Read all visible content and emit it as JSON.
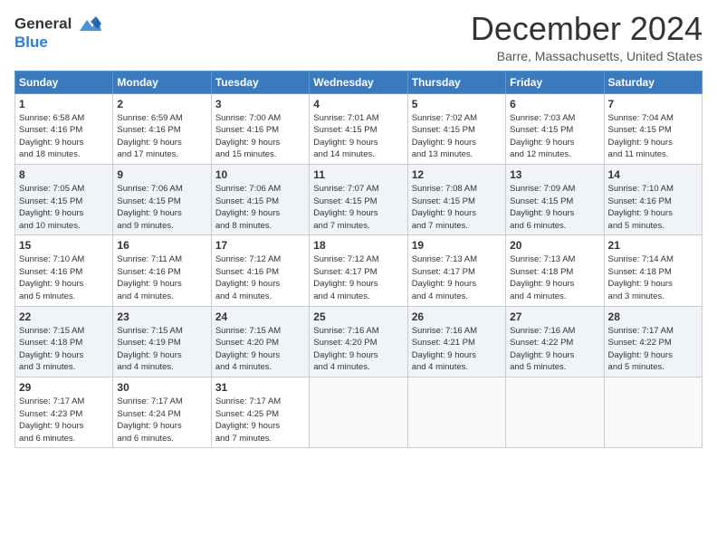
{
  "header": {
    "logo_line1": "General",
    "logo_line2": "Blue",
    "month": "December 2024",
    "location": "Barre, Massachusetts, United States"
  },
  "days_of_week": [
    "Sunday",
    "Monday",
    "Tuesday",
    "Wednesday",
    "Thursday",
    "Friday",
    "Saturday"
  ],
  "weeks": [
    [
      {
        "day": "1",
        "info": "Sunrise: 6:58 AM\nSunset: 4:16 PM\nDaylight: 9 hours\nand 18 minutes."
      },
      {
        "day": "2",
        "info": "Sunrise: 6:59 AM\nSunset: 4:16 PM\nDaylight: 9 hours\nand 17 minutes."
      },
      {
        "day": "3",
        "info": "Sunrise: 7:00 AM\nSunset: 4:16 PM\nDaylight: 9 hours\nand 15 minutes."
      },
      {
        "day": "4",
        "info": "Sunrise: 7:01 AM\nSunset: 4:15 PM\nDaylight: 9 hours\nand 14 minutes."
      },
      {
        "day": "5",
        "info": "Sunrise: 7:02 AM\nSunset: 4:15 PM\nDaylight: 9 hours\nand 13 minutes."
      },
      {
        "day": "6",
        "info": "Sunrise: 7:03 AM\nSunset: 4:15 PM\nDaylight: 9 hours\nand 12 minutes."
      },
      {
        "day": "7",
        "info": "Sunrise: 7:04 AM\nSunset: 4:15 PM\nDaylight: 9 hours\nand 11 minutes."
      }
    ],
    [
      {
        "day": "8",
        "info": "Sunrise: 7:05 AM\nSunset: 4:15 PM\nDaylight: 9 hours\nand 10 minutes."
      },
      {
        "day": "9",
        "info": "Sunrise: 7:06 AM\nSunset: 4:15 PM\nDaylight: 9 hours\nand 9 minutes."
      },
      {
        "day": "10",
        "info": "Sunrise: 7:06 AM\nSunset: 4:15 PM\nDaylight: 9 hours\nand 8 minutes."
      },
      {
        "day": "11",
        "info": "Sunrise: 7:07 AM\nSunset: 4:15 PM\nDaylight: 9 hours\nand 7 minutes."
      },
      {
        "day": "12",
        "info": "Sunrise: 7:08 AM\nSunset: 4:15 PM\nDaylight: 9 hours\nand 7 minutes."
      },
      {
        "day": "13",
        "info": "Sunrise: 7:09 AM\nSunset: 4:15 PM\nDaylight: 9 hours\nand 6 minutes."
      },
      {
        "day": "14",
        "info": "Sunrise: 7:10 AM\nSunset: 4:16 PM\nDaylight: 9 hours\nand 5 minutes."
      }
    ],
    [
      {
        "day": "15",
        "info": "Sunrise: 7:10 AM\nSunset: 4:16 PM\nDaylight: 9 hours\nand 5 minutes."
      },
      {
        "day": "16",
        "info": "Sunrise: 7:11 AM\nSunset: 4:16 PM\nDaylight: 9 hours\nand 4 minutes."
      },
      {
        "day": "17",
        "info": "Sunrise: 7:12 AM\nSunset: 4:16 PM\nDaylight: 9 hours\nand 4 minutes."
      },
      {
        "day": "18",
        "info": "Sunrise: 7:12 AM\nSunset: 4:17 PM\nDaylight: 9 hours\nand 4 minutes."
      },
      {
        "day": "19",
        "info": "Sunrise: 7:13 AM\nSunset: 4:17 PM\nDaylight: 9 hours\nand 4 minutes."
      },
      {
        "day": "20",
        "info": "Sunrise: 7:13 AM\nSunset: 4:18 PM\nDaylight: 9 hours\nand 4 minutes."
      },
      {
        "day": "21",
        "info": "Sunrise: 7:14 AM\nSunset: 4:18 PM\nDaylight: 9 hours\nand 3 minutes."
      }
    ],
    [
      {
        "day": "22",
        "info": "Sunrise: 7:15 AM\nSunset: 4:18 PM\nDaylight: 9 hours\nand 3 minutes."
      },
      {
        "day": "23",
        "info": "Sunrise: 7:15 AM\nSunset: 4:19 PM\nDaylight: 9 hours\nand 4 minutes."
      },
      {
        "day": "24",
        "info": "Sunrise: 7:15 AM\nSunset: 4:20 PM\nDaylight: 9 hours\nand 4 minutes."
      },
      {
        "day": "25",
        "info": "Sunrise: 7:16 AM\nSunset: 4:20 PM\nDaylight: 9 hours\nand 4 minutes."
      },
      {
        "day": "26",
        "info": "Sunrise: 7:16 AM\nSunset: 4:21 PM\nDaylight: 9 hours\nand 4 minutes."
      },
      {
        "day": "27",
        "info": "Sunrise: 7:16 AM\nSunset: 4:22 PM\nDaylight: 9 hours\nand 5 minutes."
      },
      {
        "day": "28",
        "info": "Sunrise: 7:17 AM\nSunset: 4:22 PM\nDaylight: 9 hours\nand 5 minutes."
      }
    ],
    [
      {
        "day": "29",
        "info": "Sunrise: 7:17 AM\nSunset: 4:23 PM\nDaylight: 9 hours\nand 6 minutes."
      },
      {
        "day": "30",
        "info": "Sunrise: 7:17 AM\nSunset: 4:24 PM\nDaylight: 9 hours\nand 6 minutes."
      },
      {
        "day": "31",
        "info": "Sunrise: 7:17 AM\nSunset: 4:25 PM\nDaylight: 9 hours\nand 7 minutes."
      },
      null,
      null,
      null,
      null
    ]
  ]
}
